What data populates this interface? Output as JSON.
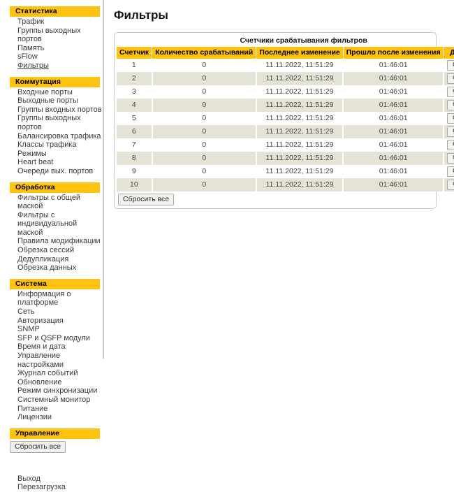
{
  "sidebar": {
    "sections": [
      {
        "title": "Статистика",
        "items": [
          {
            "label": "Трафик",
            "active": false
          },
          {
            "label": "Группы выходных портов",
            "active": false
          },
          {
            "label": "Память",
            "active": false
          },
          {
            "label": "sFlow",
            "active": false
          },
          {
            "label": "Фильтры",
            "active": true
          }
        ]
      },
      {
        "title": "Коммутация",
        "items": [
          {
            "label": "Входные порты",
            "active": false
          },
          {
            "label": "Выходные порты",
            "active": false
          },
          {
            "label": "Группы входных портов",
            "active": false
          },
          {
            "label": "Группы выходных портов",
            "active": false
          },
          {
            "label": "Балансировка трафика",
            "active": false
          },
          {
            "label": "Классы трафика",
            "active": false
          },
          {
            "label": "Режимы",
            "active": false
          },
          {
            "label": "Heart beat",
            "active": false
          },
          {
            "label": "Очереди вых. портов",
            "active": false
          }
        ]
      },
      {
        "title": "Обработка",
        "items": [
          {
            "label": "Фильтры с общей маской",
            "active": false
          },
          {
            "label": "Фильтры с индивидуальной маской",
            "active": false
          },
          {
            "label": "Правила модификации",
            "active": false
          },
          {
            "label": "Обрезка сессий",
            "active": false
          },
          {
            "label": "Дедупликация",
            "active": false
          },
          {
            "label": "Обрезка данных",
            "active": false
          }
        ]
      },
      {
        "title": "Система",
        "items": [
          {
            "label": "Информация о платформе",
            "active": false
          },
          {
            "label": "Сеть",
            "active": false
          },
          {
            "label": "Авторизация",
            "active": false
          },
          {
            "label": "SNMP",
            "active": false
          },
          {
            "label": "SFP и QSFP модули",
            "active": false
          },
          {
            "label": "Время и дата",
            "active": false
          },
          {
            "label": "Управление настройками",
            "active": false
          },
          {
            "label": "Журнал событий",
            "active": false
          },
          {
            "label": "Обновление",
            "active": false
          },
          {
            "label": "Режим синхронизации",
            "active": false
          },
          {
            "label": "Системный монитор",
            "active": false
          },
          {
            "label": "Питание",
            "active": false
          },
          {
            "label": "Лицензии",
            "active": false
          }
        ]
      },
      {
        "title": "Управление",
        "items": []
      }
    ],
    "reset_all_label": "Сбросить все",
    "footer_links": [
      {
        "label": "Выход"
      },
      {
        "label": "Перезагрузка"
      }
    ]
  },
  "main": {
    "page_title": "Фильтры",
    "table": {
      "caption": "Счетчики срабатывания фильтров",
      "columns": [
        "Счетчик",
        "Количество срабатываний",
        "Последнее изменение",
        "Прошло после изменения",
        "Действие"
      ],
      "rows": [
        {
          "counter": "1",
          "count": "0",
          "last_change": "11.11.2022, 11:51:29",
          "elapsed": "01:46:01",
          "action": "Сбросить"
        },
        {
          "counter": "2",
          "count": "0",
          "last_change": "11.11.2022, 11:51:29",
          "elapsed": "01:46:01",
          "action": "Сбросить"
        },
        {
          "counter": "3",
          "count": "0",
          "last_change": "11.11.2022, 11:51:29",
          "elapsed": "01:46:01",
          "action": "Сбросить"
        },
        {
          "counter": "4",
          "count": "0",
          "last_change": "11.11.2022, 11:51:29",
          "elapsed": "01:46:01",
          "action": "Сбросить"
        },
        {
          "counter": "5",
          "count": "0",
          "last_change": "11.11.2022, 11:51:29",
          "elapsed": "01:46:01",
          "action": "Сбросить"
        },
        {
          "counter": "6",
          "count": "0",
          "last_change": "11.11.2022, 11:51:29",
          "elapsed": "01:46:01",
          "action": "Сбросить"
        },
        {
          "counter": "7",
          "count": "0",
          "last_change": "11.11.2022, 11:51:29",
          "elapsed": "01:46:01",
          "action": "Сбросить"
        },
        {
          "counter": "8",
          "count": "0",
          "last_change": "11.11.2022, 11:51:29",
          "elapsed": "01:46:01",
          "action": "Сбросить"
        },
        {
          "counter": "9",
          "count": "0",
          "last_change": "11.11.2022, 11:51:29",
          "elapsed": "01:46:01",
          "action": "Сбросить"
        },
        {
          "counter": "10",
          "count": "0",
          "last_change": "11.11.2022, 11:51:29",
          "elapsed": "01:46:01",
          "action": "Сбросить"
        }
      ],
      "reset_all_label": "Сбросить все"
    }
  },
  "colors": {
    "accent": "#ffc20e",
    "row_alt": "#e5e2d6",
    "text": "#3b3b3b",
    "border": "#c8c8c8"
  }
}
